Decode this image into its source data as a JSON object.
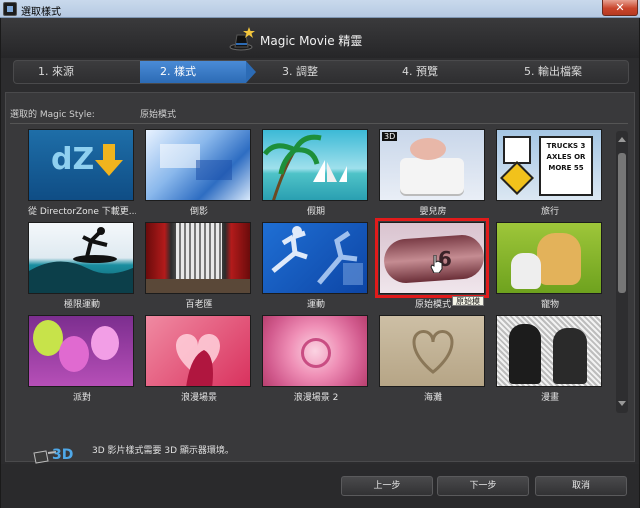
{
  "window": {
    "title": "選取樣式",
    "close_label": "✕"
  },
  "app": {
    "name": "Magic Movie 精靈"
  },
  "steps": [
    {
      "label": "1. 來源",
      "active": false
    },
    {
      "label": "2. 樣式",
      "active": true
    },
    {
      "label": "3. 調整",
      "active": false
    },
    {
      "label": "4. 預覽",
      "active": false
    },
    {
      "label": "5. 輸出檔案",
      "active": false
    }
  ],
  "style": {
    "label": "選取的 Magic Style:",
    "value": "原始模式"
  },
  "tiles": [
    {
      "label": "從 DirectorZone 下載更...",
      "thumb": "directorzone",
      "tag": "dZ"
    },
    {
      "label": "倒影",
      "thumb": "reflection"
    },
    {
      "label": "假期",
      "thumb": "holiday"
    },
    {
      "label": "嬰兒房",
      "thumb": "nursery",
      "badge": "3D"
    },
    {
      "label": "旅行",
      "thumb": "travel",
      "sign": "TRUCKS 3 AXLES OR MORE 55"
    },
    {
      "label": "極限運動",
      "thumb": "surf"
    },
    {
      "label": "百老匯",
      "thumb": "broadway"
    },
    {
      "label": "運動",
      "thumb": "sports"
    },
    {
      "label": "原始模式",
      "thumb": "film",
      "selected": true,
      "tooltip": "原始模",
      "film_number": "6"
    },
    {
      "label": "寵物",
      "thumb": "pets"
    },
    {
      "label": "派對",
      "thumb": "party"
    },
    {
      "label": "浪漫場景",
      "thumb": "romance"
    },
    {
      "label": "浪漫場景 2",
      "thumb": "rose"
    },
    {
      "label": "海灘",
      "thumb": "beach"
    },
    {
      "label": "漫畫",
      "thumb": "comic"
    }
  ],
  "note": {
    "text": "3D 影片樣式需要 3D 顯示器環境。",
    "icon_text": "3D"
  },
  "buttons": {
    "prev": "上一步",
    "next": "下一步",
    "cancel": "取消"
  },
  "colors": {
    "accent": "#2c6bb5",
    "selection": "#e11b1b"
  }
}
